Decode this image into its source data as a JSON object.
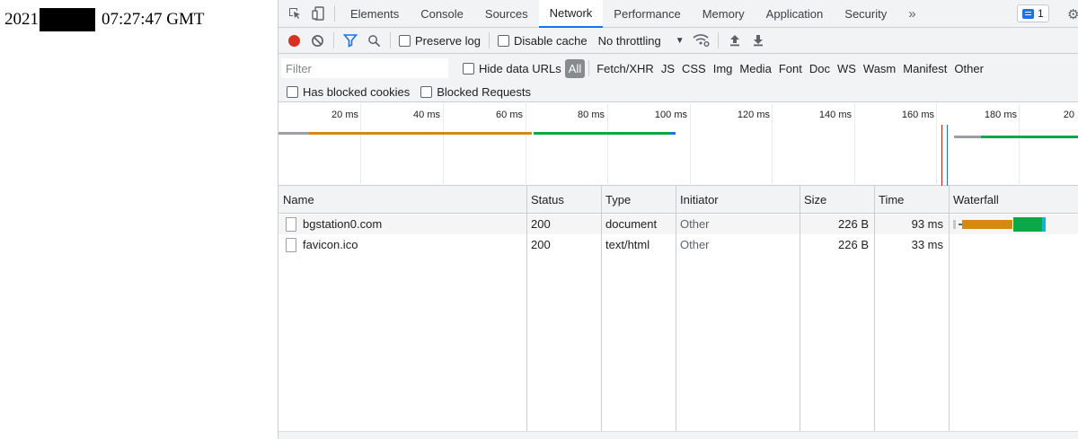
{
  "page": {
    "date_prefix": "2021",
    "date_suffix": "07:27:47 GMT"
  },
  "devtools": {
    "tabs": [
      {
        "label": "Elements"
      },
      {
        "label": "Console"
      },
      {
        "label": "Sources"
      },
      {
        "label": "Network",
        "active": true
      },
      {
        "label": "Performance"
      },
      {
        "label": "Memory"
      },
      {
        "label": "Application"
      },
      {
        "label": "Security"
      }
    ],
    "more_tabs": "»",
    "issues_count": "1",
    "toolbar": {
      "preserve_log": "Preserve log",
      "disable_cache": "Disable cache",
      "throttling": "No throttling"
    },
    "filter": {
      "placeholder": "Filter",
      "hide_data_urls": "Hide data URLs",
      "types": [
        "All",
        "Fetch/XHR",
        "JS",
        "CSS",
        "Img",
        "Media",
        "Font",
        "Doc",
        "WS",
        "Wasm",
        "Manifest",
        "Other"
      ],
      "selected_type": "All",
      "has_blocked_cookies": "Has blocked cookies",
      "blocked_requests": "Blocked Requests"
    },
    "overview": {
      "ticks": [
        "20 ms",
        "40 ms",
        "60 ms",
        "80 ms",
        "100 ms",
        "120 ms",
        "140 ms",
        "160 ms",
        "180 ms",
        "20"
      ]
    },
    "table": {
      "columns": [
        "Name",
        "Status",
        "Type",
        "Initiator",
        "Size",
        "Time",
        "Waterfall"
      ],
      "rows": [
        {
          "name": "bgstation0.com",
          "status": "200",
          "type": "document",
          "initiator": "Other",
          "size": "226 B",
          "time": "93 ms"
        },
        {
          "name": "favicon.ico",
          "status": "200",
          "type": "text/html",
          "initiator": "Other",
          "size": "226 B",
          "time": "33 ms"
        }
      ]
    },
    "colors": {
      "accent": "#1a73e8",
      "record": "#d93025",
      "waiting": "#d68910",
      "download": "#0ba84a",
      "connection": "#9aa0a6"
    }
  }
}
